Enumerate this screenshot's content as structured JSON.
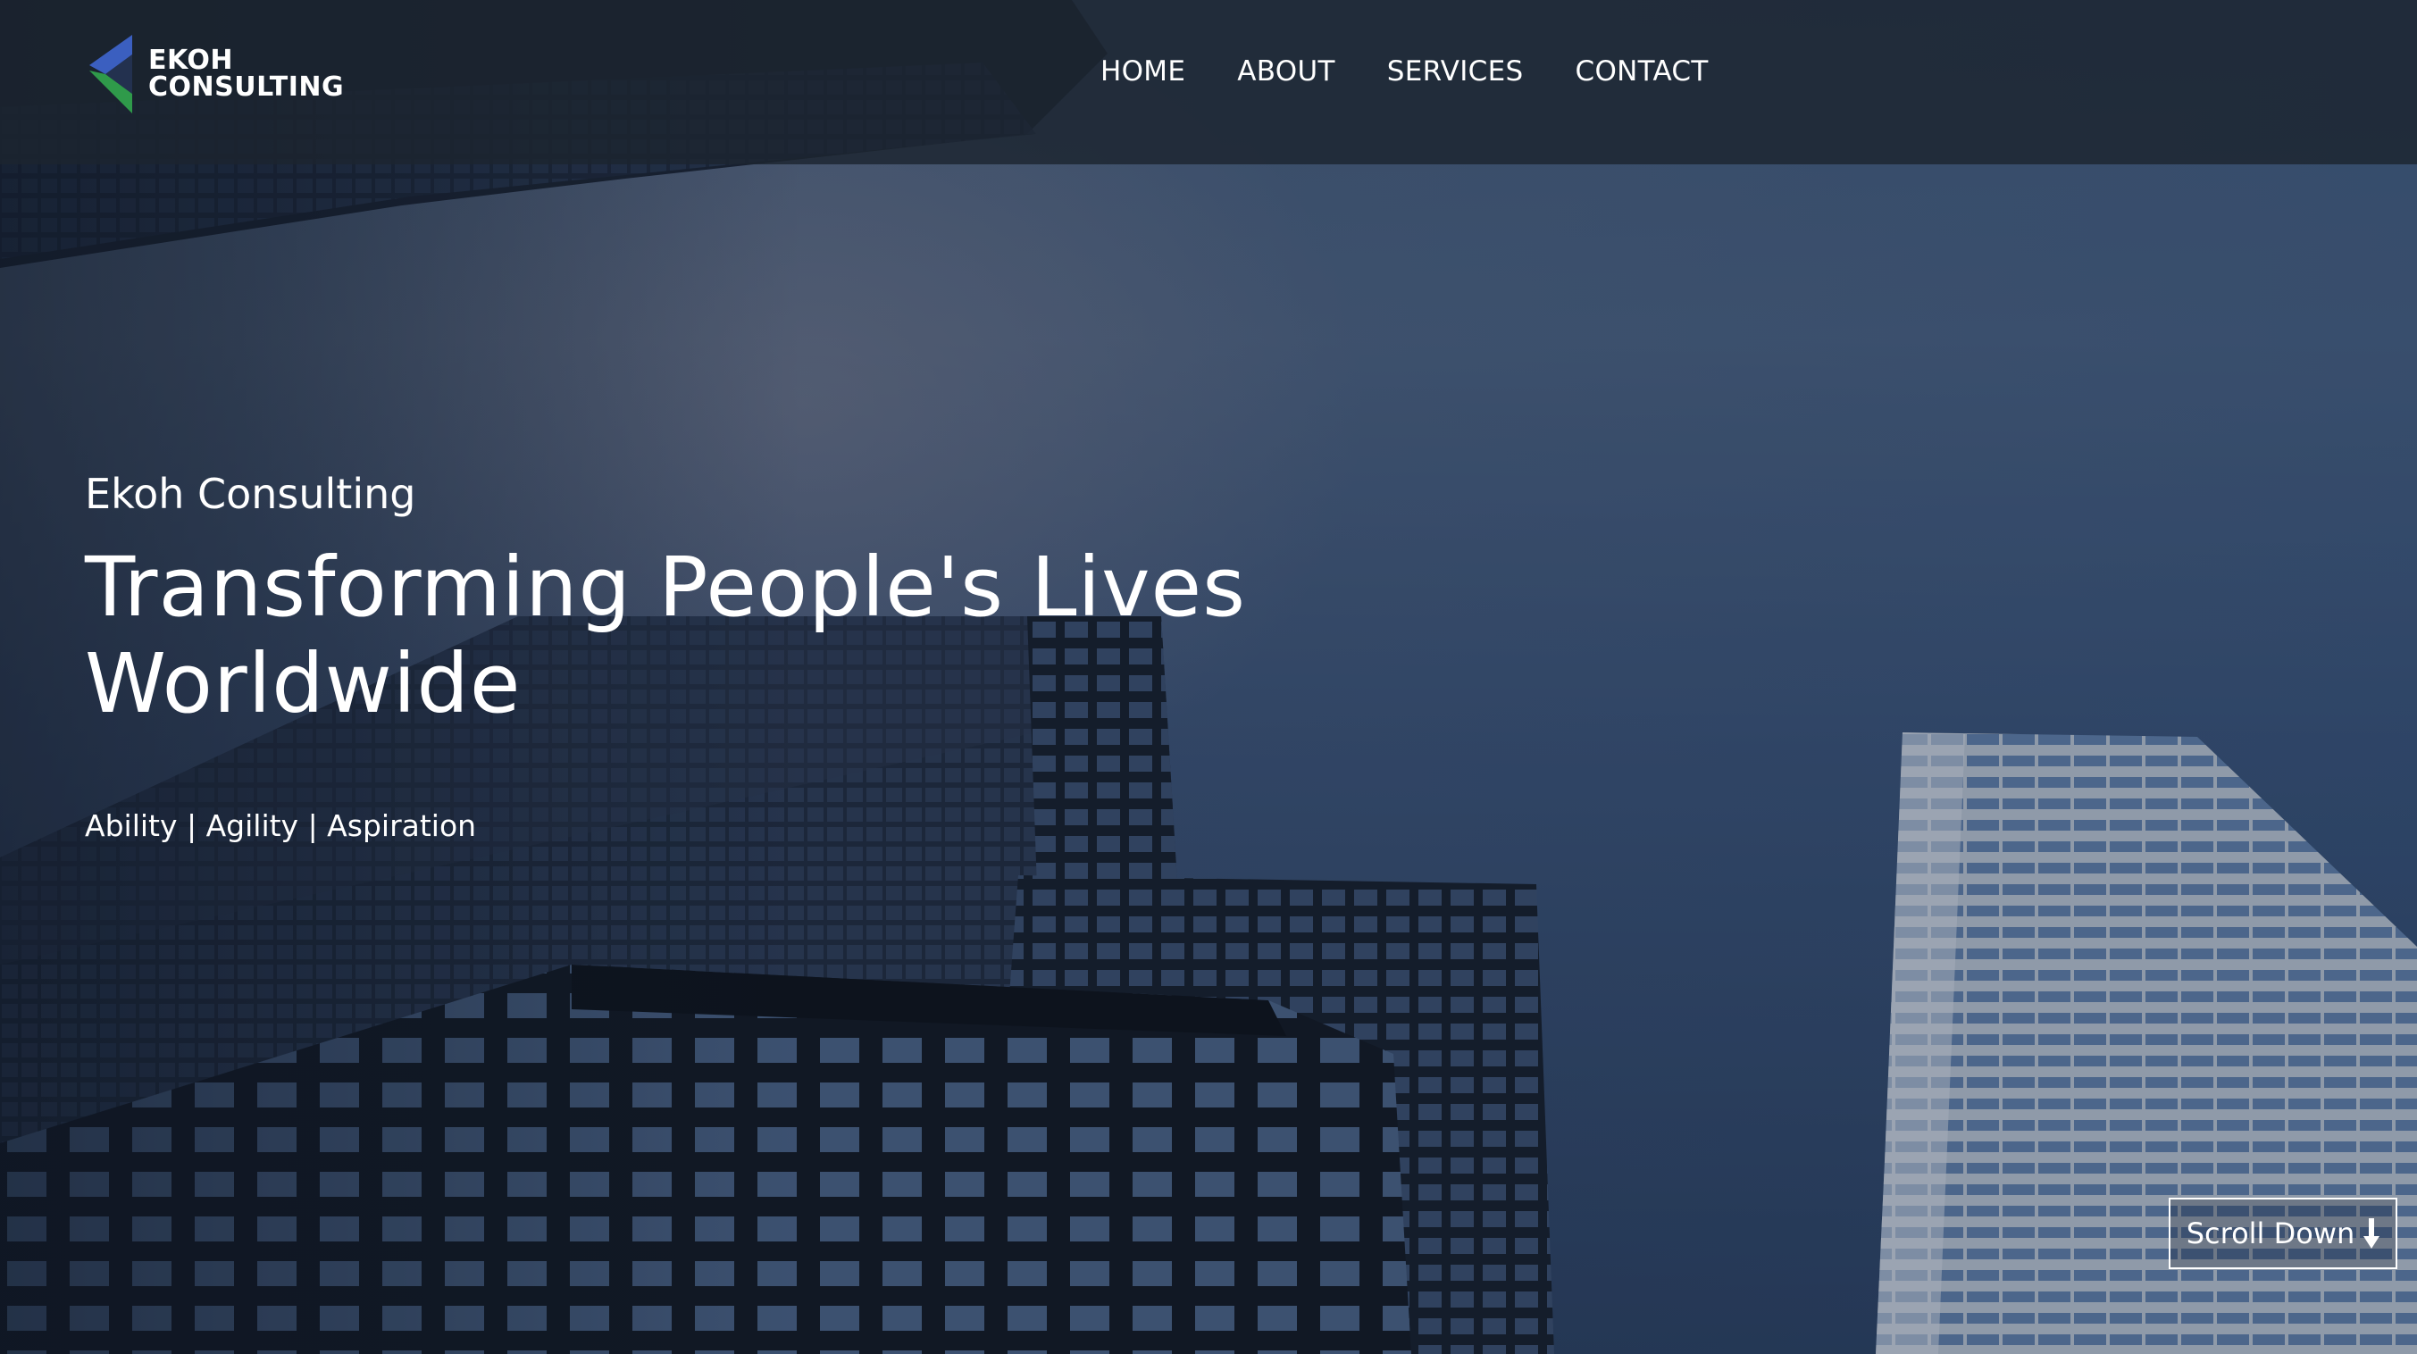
{
  "header": {
    "logo": {
      "line1": "EKOH",
      "line2": "CONSULTING",
      "colors": {
        "blue": "#3b5fc0",
        "green": "#2f9a4a"
      }
    },
    "nav": [
      {
        "label": "HOME"
      },
      {
        "label": "ABOUT"
      },
      {
        "label": "SERVICES"
      },
      {
        "label": "CONTACT"
      }
    ]
  },
  "hero": {
    "kicker": "Ekoh Consulting",
    "title_line1": "Transforming People's Lives",
    "title_line2": "Worldwide",
    "tagline": "Ability | Agility | Aspiration",
    "scroll_label": "Scroll Down",
    "scroll_icon": "arrow-down-icon"
  },
  "colors": {
    "header_bg": "#1c2430",
    "text": "#ffffff"
  }
}
